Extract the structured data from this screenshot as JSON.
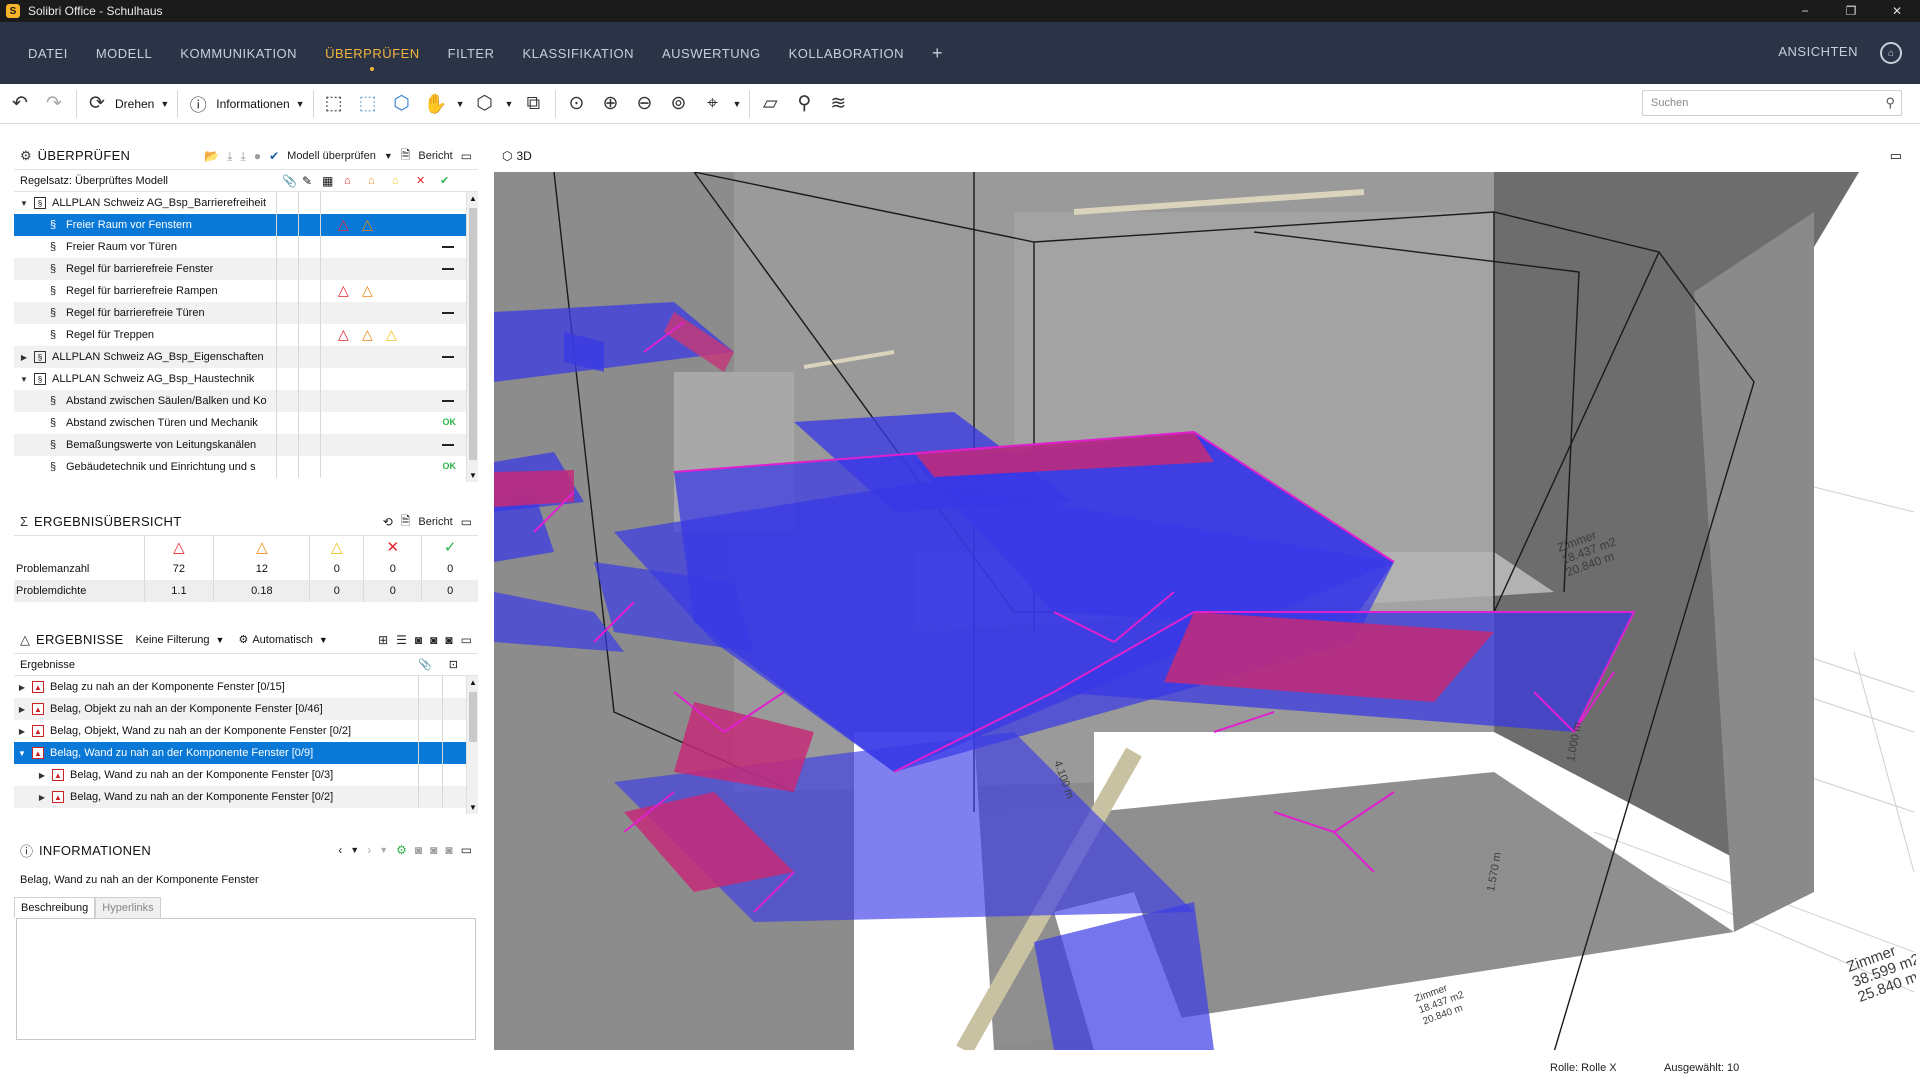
{
  "window": {
    "title": "Solibri Office - Schulhaus",
    "app_icon": "S",
    "minimize": "−",
    "restore": "❐",
    "close": "✕"
  },
  "menu": {
    "items": [
      {
        "label": "DATEI",
        "active": false
      },
      {
        "label": "MODELL",
        "active": false
      },
      {
        "label": "KOMMUNIKATION",
        "active": false
      },
      {
        "label": "ÜBERPRÜFEN",
        "active": true
      },
      {
        "label": "FILTER",
        "active": false
      },
      {
        "label": "KLASSIFIKATION",
        "active": false
      },
      {
        "label": "AUSWERTUNG",
        "active": false
      },
      {
        "label": "KOLLABORATION",
        "active": false
      }
    ],
    "plus": "+",
    "right_label": "ANSICHTEN"
  },
  "toolbar": {
    "rotate_label": "Drehen",
    "info_label": "Informationen",
    "search_placeholder": "Suchen"
  },
  "check_panel": {
    "title": "ÜBERPRÜFEN",
    "check_model_label": "Modell überprüfen",
    "report_label": "Bericht",
    "ruleset_header": "Regelsatz: Überprüftes Modell",
    "rows": [
      {
        "level": 0,
        "expanded": true,
        "type": "ruleset",
        "label": "ALLPLAN Schweiz AG_Bsp_Barrierefreiheit",
        "status": "",
        "selected": false,
        "alt": false,
        "marks": []
      },
      {
        "level": 1,
        "type": "rule",
        "label": "Freier Raum vor Fenstern",
        "selected": true,
        "alt": false,
        "marks": [
          "red",
          "orange"
        ],
        "status": ""
      },
      {
        "level": 1,
        "type": "rule",
        "label": "Freier Raum vor Türen",
        "selected": false,
        "alt": false,
        "marks": [],
        "status": "dash"
      },
      {
        "level": 1,
        "type": "rule",
        "label": "Regel für barrierefreie Fenster",
        "selected": false,
        "alt": true,
        "marks": [],
        "status": "dash"
      },
      {
        "level": 1,
        "type": "rule",
        "label": "Regel für barrierefreie Rampen",
        "selected": false,
        "alt": false,
        "marks": [
          "red",
          "orange"
        ],
        "status": ""
      },
      {
        "level": 1,
        "type": "rule",
        "label": "Regel für barrierefreie Türen",
        "selected": false,
        "alt": true,
        "marks": [],
        "status": "dash"
      },
      {
        "level": 1,
        "type": "rule",
        "label": "Regel für Treppen",
        "selected": false,
        "alt": false,
        "marks": [
          "red",
          "orange",
          "yellow"
        ],
        "status": ""
      },
      {
        "level": 0,
        "expanded": false,
        "type": "ruleset",
        "label": "ALLPLAN Schweiz AG_Bsp_Eigenschaften",
        "selected": false,
        "alt": true,
        "marks": [],
        "status": "dash"
      },
      {
        "level": 0,
        "expanded": true,
        "type": "ruleset",
        "label": "ALLPLAN Schweiz AG_Bsp_Haustechnik",
        "selected": false,
        "alt": false,
        "marks": [],
        "status": ""
      },
      {
        "level": 1,
        "type": "rule",
        "label": "Abstand zwischen Säulen/Balken und Ko",
        "selected": false,
        "alt": true,
        "marks": [],
        "status": "dash"
      },
      {
        "level": 1,
        "type": "rule",
        "label": "Abstand zwischen Türen  und Mechanik",
        "selected": false,
        "alt": false,
        "marks": [],
        "status": "ok"
      },
      {
        "level": 1,
        "type": "rule",
        "label": "Bemaßungswerte von Leitungskanälen",
        "selected": false,
        "alt": true,
        "marks": [],
        "status": "dash"
      },
      {
        "level": 1,
        "type": "rule",
        "label": "Gebäudetechnik und Einrichtung und s",
        "selected": false,
        "alt": false,
        "marks": [],
        "status": "ok"
      }
    ],
    "ok_text": "OK"
  },
  "overview_panel": {
    "title": "ERGEBNISÜBERSICHT",
    "report_label": "Bericht",
    "rows": [
      {
        "label": "Problemanzahl",
        "values": [
          "72",
          "12",
          "0",
          "0",
          "0"
        ]
      },
      {
        "label": "Problemdichte",
        "values": [
          "1.1",
          "0.18",
          "0",
          "0",
          "0"
        ]
      }
    ]
  },
  "results_panel": {
    "title": "ERGEBNISSE",
    "filter_label": "Keine Filterung",
    "auto_label": "Automatisch",
    "column_header": "Ergebnisse",
    "rows": [
      {
        "level": 0,
        "expanded": false,
        "label": "Belag zu nah an der Komponente Fenster [0/15]",
        "selected": false,
        "alt": false
      },
      {
        "level": 0,
        "expanded": false,
        "label": "Belag, Objekt zu nah an der Komponente Fenster [0/46]",
        "selected": false,
        "alt": true
      },
      {
        "level": 0,
        "expanded": false,
        "label": "Belag, Objekt, Wand zu nah an der Komponente Fenster [0/2]",
        "selected": false,
        "alt": false
      },
      {
        "level": 0,
        "expanded": true,
        "label": "Belag, Wand zu nah an der Komponente Fenster [0/9]",
        "selected": true,
        "alt": false
      },
      {
        "level": 1,
        "expanded": false,
        "label": "Belag, Wand zu nah an der Komponente Fenster [0/3]",
        "selected": false,
        "alt": false
      },
      {
        "level": 1,
        "expanded": false,
        "label": "Belag, Wand zu nah an der Komponente Fenster [0/2]",
        "selected": false,
        "alt": true
      }
    ]
  },
  "info_panel": {
    "title": "INFORMATIONEN",
    "text": "Belag, Wand zu nah an der Komponente Fenster",
    "tab_description": "Beschreibung",
    "tab_hyperlinks": "Hyperlinks"
  },
  "viewport": {
    "label": "3D",
    "room_labels": [
      {
        "lines": [
          "Zimmer",
          "18.437 m2",
          "20.840 m"
        ]
      },
      {
        "lines": [
          "Zimmer",
          "18.437 m2",
          "20.840 m"
        ]
      },
      {
        "lines": [
          "Zimmer",
          "38.599 m2",
          "25.840 m"
        ]
      }
    ],
    "dimension_labels": [
      "4.100 m",
      "1.570 m",
      "1.000 m"
    ]
  },
  "status": {
    "role": "Rolle: Rolle X",
    "selected": "Ausgewählt: 10"
  },
  "colors": {
    "menu_bg": "#2b3447",
    "accent": "#f2b43c",
    "selection": "#0a78d7",
    "issue_red": "#e1262c",
    "issue_orange": "#ef8a16",
    "issue_yellow": "#f1c51c",
    "ok_green": "#2fb34a",
    "highlight_blue": "#4040f0",
    "highlight_magenta": "#e020d0"
  }
}
